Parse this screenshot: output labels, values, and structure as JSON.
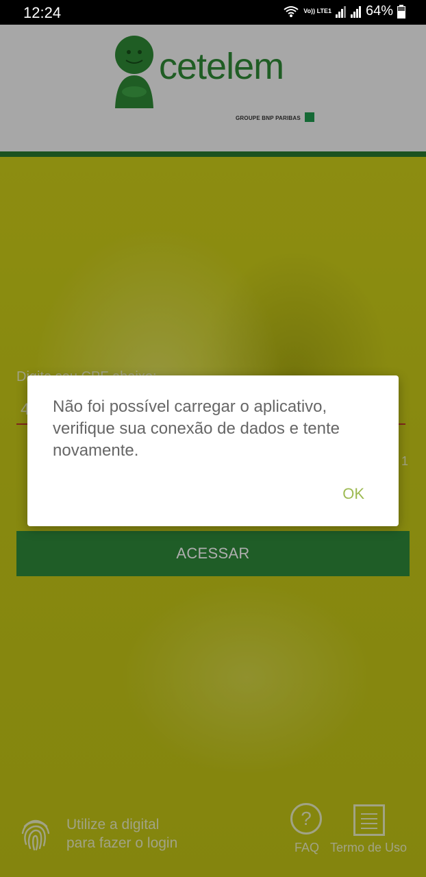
{
  "status_bar": {
    "time": "12:24",
    "network_label": "Vo)) LTE1",
    "battery_percent": "64%",
    "icons": [
      "wifi-icon",
      "signal-icon",
      "signal-icon",
      "battery-icon"
    ]
  },
  "header": {
    "brand_name": "cetelem",
    "brand_tagline": "GROUPE BNP PARIBAS",
    "colors": {
      "brand_green": "#2f8a36",
      "header_bg": "#f6f6f6",
      "bar_green": "#2a7a2f"
    }
  },
  "login_form": {
    "cpf_label": "Digite seu CPF abaixo:",
    "cpf_value": "4",
    "counter": "1",
    "submit_label": "ACESSAR",
    "colors": {
      "button_bg": "#2e8a3a",
      "field_underline": "#c0392b",
      "background": "#c9cb18"
    }
  },
  "footer": {
    "fingerprint_text_line1": "Utilize a digital",
    "fingerprint_text_line2": "para fazer o login",
    "faq_icon_glyph": "?",
    "faq_label": "FAQ",
    "terms_label": "Termo de Uso"
  },
  "dialog": {
    "message": "Não foi possível carregar o aplicativo, verifique sua conexão de dados e tente novamente.",
    "ok_label": "OK",
    "colors": {
      "ok_text": "#9dba52"
    }
  }
}
